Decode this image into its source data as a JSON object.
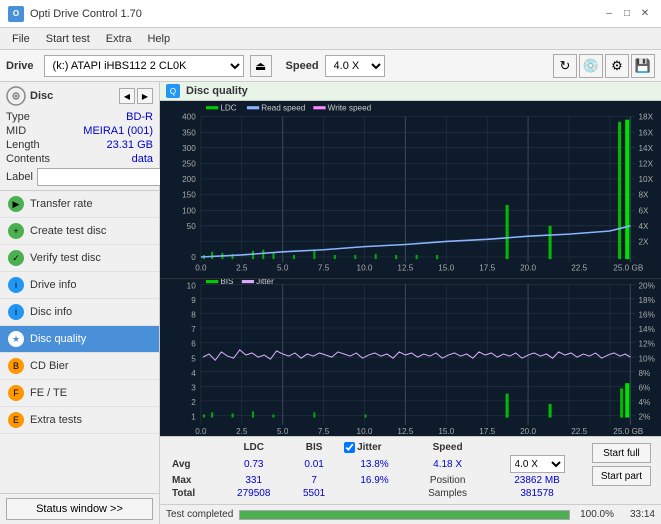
{
  "titlebar": {
    "title": "Opti Drive Control 1.70",
    "minimize_label": "–",
    "maximize_label": "□",
    "close_label": "✕"
  },
  "menubar": {
    "items": [
      "File",
      "Start test",
      "Extra",
      "Help"
    ]
  },
  "drive_toolbar": {
    "label": "Drive",
    "drive_value": "(k:) ATAPI iHBS112  2 CL0K",
    "speed_label": "Speed",
    "speed_value": "4.0 X"
  },
  "disc": {
    "title": "Disc",
    "type_label": "Type",
    "type_value": "BD-R",
    "mid_label": "MID",
    "mid_value": "MEIRA1 (001)",
    "length_label": "Length",
    "length_value": "23.31 GB",
    "contents_label": "Contents",
    "contents_value": "data",
    "label_label": "Label"
  },
  "sidebar_items": [
    {
      "id": "transfer-rate",
      "label": "Transfer rate",
      "color": "green"
    },
    {
      "id": "create-test-disc",
      "label": "Create test disc",
      "color": "green"
    },
    {
      "id": "verify-test-disc",
      "label": "Verify test disc",
      "color": "green"
    },
    {
      "id": "drive-info",
      "label": "Drive info",
      "color": "blue"
    },
    {
      "id": "disc-info",
      "label": "Disc info",
      "color": "blue"
    },
    {
      "id": "disc-quality",
      "label": "Disc quality",
      "color": "blue",
      "active": true
    },
    {
      "id": "cd-bier",
      "label": "CD Bier",
      "color": "orange"
    },
    {
      "id": "fe-te",
      "label": "FE / TE",
      "color": "orange"
    },
    {
      "id": "extra-tests",
      "label": "Extra tests",
      "color": "orange"
    }
  ],
  "quality_panel": {
    "title": "Disc quality"
  },
  "chart1": {
    "legend": [
      {
        "id": "ldc",
        "label": "LDC"
      },
      {
        "id": "read",
        "label": "Read speed"
      },
      {
        "id": "write",
        "label": "Write speed"
      }
    ],
    "y_axis_left": [
      "400",
      "350",
      "300",
      "250",
      "200",
      "150",
      "100",
      "50",
      "0"
    ],
    "y_axis_right": [
      "18X",
      "16X",
      "14X",
      "12X",
      "10X",
      "8X",
      "6X",
      "4X",
      "2X"
    ],
    "x_axis": [
      "0.0",
      "2.5",
      "5.0",
      "7.5",
      "10.0",
      "12.5",
      "15.0",
      "17.5",
      "20.0",
      "22.5",
      "25.0 GB"
    ]
  },
  "chart2": {
    "legend": [
      {
        "id": "bis",
        "label": "BIS"
      },
      {
        "id": "jitter",
        "label": "Jitter"
      }
    ],
    "y_axis_left": [
      "10",
      "9",
      "8",
      "7",
      "6",
      "5",
      "4",
      "3",
      "2",
      "1"
    ],
    "y_axis_right": [
      "20%",
      "18%",
      "16%",
      "14%",
      "12%",
      "10%",
      "8%",
      "6%",
      "4%",
      "2%"
    ],
    "x_axis": [
      "0.0",
      "2.5",
      "5.0",
      "7.5",
      "10.0",
      "12.5",
      "15.0",
      "17.5",
      "20.0",
      "22.5",
      "25.0 GB"
    ]
  },
  "stats": {
    "columns": [
      "",
      "LDC",
      "BIS",
      "",
      "Jitter",
      "Speed",
      ""
    ],
    "rows": [
      {
        "label": "Avg",
        "ldc": "0.73",
        "bis": "0.01",
        "jitter": "13.8%",
        "speed_label": "4.18 X",
        "speed_val": "4.0 X"
      },
      {
        "label": "Max",
        "ldc": "331",
        "bis": "7",
        "jitter": "16.9%",
        "position_label": "Position",
        "position_val": "23862 MB"
      },
      {
        "label": "Total",
        "ldc": "279508",
        "bis": "5501",
        "jitter": "",
        "samples_label": "Samples",
        "samples_val": "381578"
      }
    ],
    "jitter_checked": true,
    "jitter_label": "Jitter",
    "start_full_label": "Start full",
    "start_part_label": "Start part"
  },
  "progress": {
    "percent": "100.0%",
    "fill_width": "100",
    "time": "33:14",
    "status_text": "Test completed"
  }
}
